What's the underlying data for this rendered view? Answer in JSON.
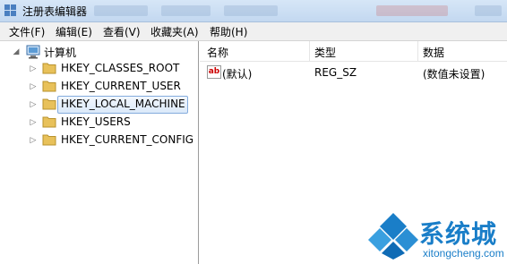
{
  "window": {
    "title": "注册表编辑器"
  },
  "menu": [
    "文件(F)",
    "编辑(E)",
    "查看(V)",
    "收藏夹(A)",
    "帮助(H)"
  ],
  "tree": {
    "root": "计算机",
    "nodes": [
      "HKEY_CLASSES_ROOT",
      "HKEY_CURRENT_USER",
      "HKEY_LOCAL_MACHINE",
      "HKEY_USERS",
      "HKEY_CURRENT_CONFIG"
    ],
    "selected": "HKEY_LOCAL_MACHINE"
  },
  "list": {
    "columns": [
      "名称",
      "类型",
      "数据"
    ],
    "rows": [
      {
        "icon": "ab-string-icon",
        "name": "(默认)",
        "type": "REG_SZ",
        "data": "(数值未设置)"
      }
    ]
  },
  "watermark": {
    "brand": "系统城",
    "url": "xitongcheng.com"
  },
  "colors": {
    "accent": "#1a7ec8",
    "selection_border": "#84acdd",
    "folder": "#e8c15a"
  }
}
